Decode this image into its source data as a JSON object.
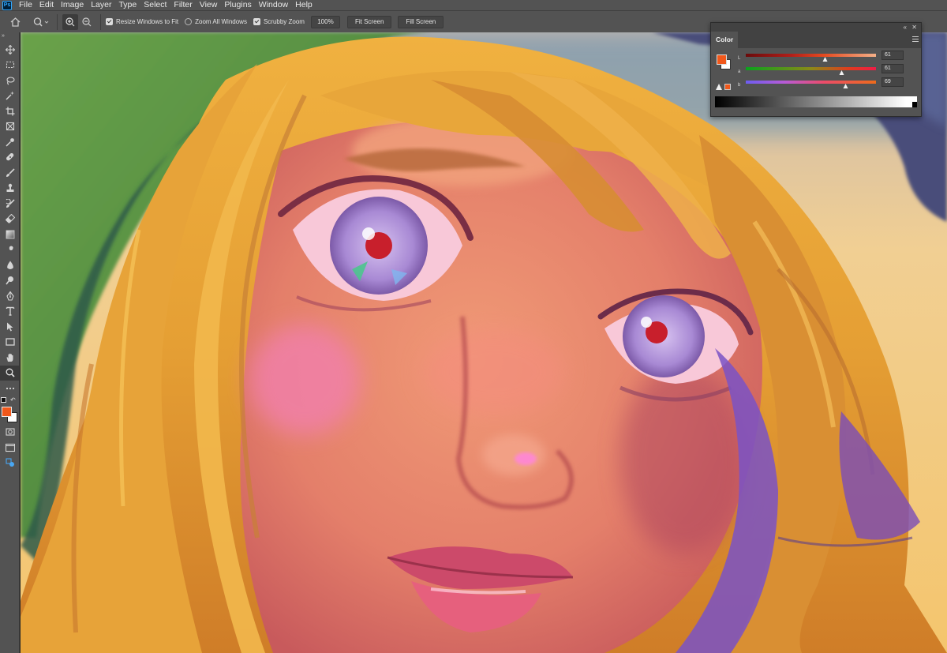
{
  "app": {
    "logo_text": "Ps"
  },
  "menu": [
    "File",
    "Edit",
    "Image",
    "Layer",
    "Type",
    "Select",
    "Filter",
    "View",
    "Plugins",
    "Window",
    "Help"
  ],
  "options_bar": {
    "resize_windows": {
      "label": "Resize Windows to Fit",
      "checked": true
    },
    "zoom_all": {
      "label": "Zoom All Windows",
      "checked": false
    },
    "scrubby_zoom": {
      "label": "Scrubby Zoom",
      "checked": true
    },
    "zoom_value": "100%",
    "fit_screen_label": "Fit Screen",
    "fill_screen_label": "Fill Screen"
  },
  "toolbar": {
    "collapse_label": "»",
    "tools": [
      "move-icon",
      "marquee-icon",
      "lasso-icon",
      "magic-wand-icon",
      "crop-icon",
      "frame-icon",
      "eyedropper-icon",
      "healing-brush-icon",
      "brush-icon",
      "clone-stamp-icon",
      "history-brush-icon",
      "eraser-icon",
      "gradient-icon",
      "smudge-icon",
      "blur-icon",
      "dodge-icon",
      "pen-icon",
      "type-icon",
      "path-selection-icon",
      "rectangle-icon",
      "hand-icon",
      "zoom-icon",
      "more-icon"
    ],
    "active_tool": "zoom-icon",
    "foreground_color": "#f1581b",
    "background_color": "#ffffff"
  },
  "color_panel": {
    "tab_label": "Color",
    "channels": [
      {
        "label": "L",
        "value": "61",
        "fraction": 0.61
      },
      {
        "label": "a",
        "value": "61",
        "fraction": 0.74
      },
      {
        "label": "b",
        "value": "69",
        "fraction": 0.77
      }
    ],
    "foreground_color": "#f1581b",
    "background_color": "#ffffff"
  },
  "colors": {
    "ui_bg": "#535353",
    "accent_orange": "#f1581b",
    "hair": "#e6a437",
    "skin": "#ea8a70",
    "iris": "#b392dd",
    "hood_green": "#5c9340",
    "bg_gold": "#f0c77c"
  }
}
